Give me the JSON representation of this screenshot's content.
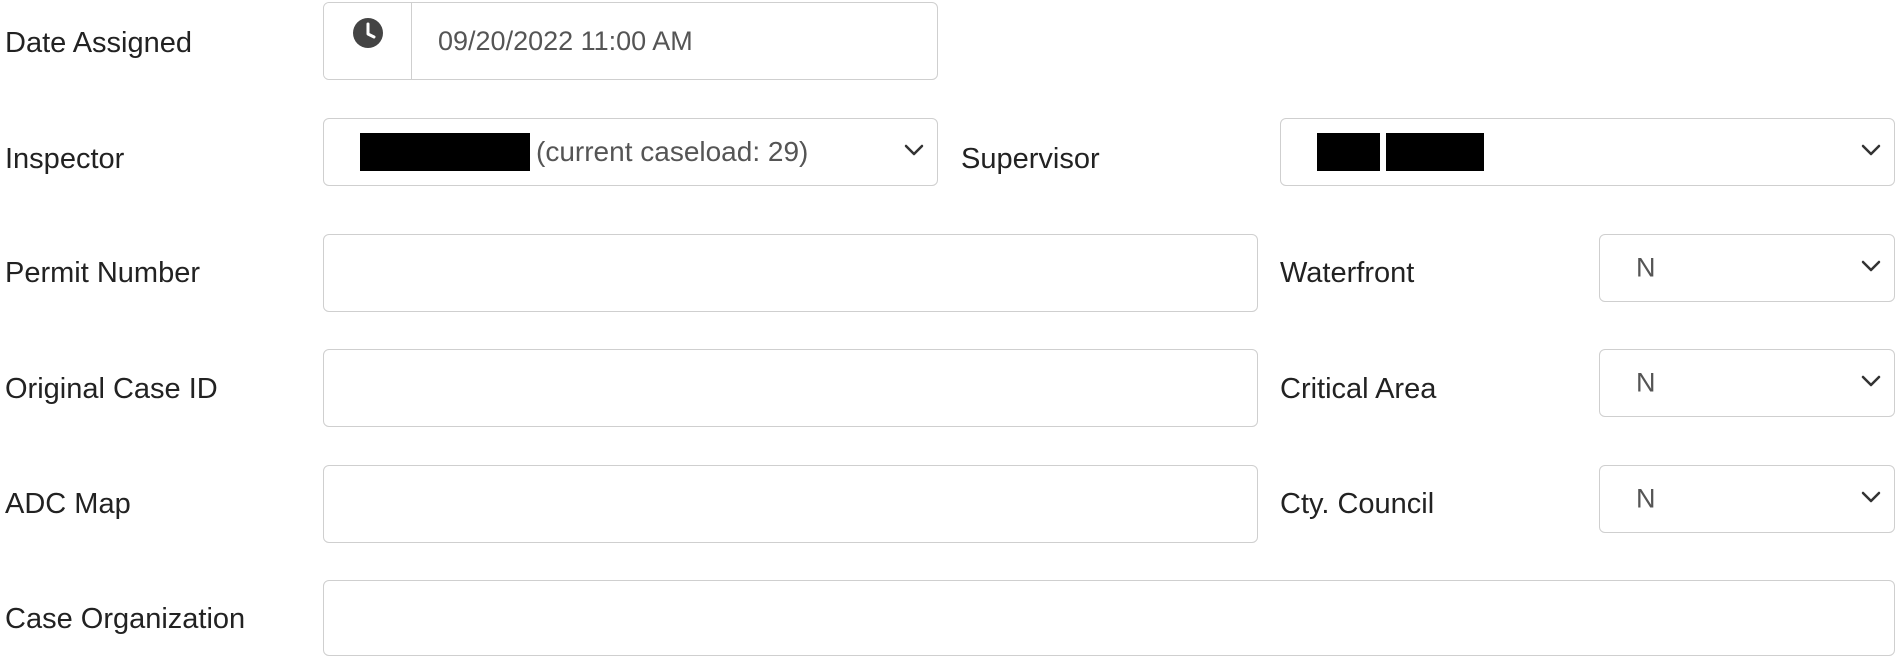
{
  "form": {
    "date_assigned": {
      "label": "Date Assigned",
      "value": "09/20/2022 11:00 AM",
      "icon": "clock-icon"
    },
    "inspector": {
      "label": "Inspector",
      "value_suffix": "(current caseload: 29)",
      "icon": "chevron-down-icon"
    },
    "supervisor": {
      "label": "Supervisor",
      "icon": "chevron-down-icon"
    },
    "permit_number": {
      "label": "Permit Number",
      "value": ""
    },
    "waterfront": {
      "label": "Waterfront",
      "value": "N"
    },
    "original_case_id": {
      "label": "Original Case ID",
      "value": ""
    },
    "critical_area": {
      "label": "Critical Area",
      "value": "N"
    },
    "adc_map": {
      "label": "ADC Map",
      "value": ""
    },
    "cty_council": {
      "label": "Cty. Council",
      "value": "N"
    },
    "case_organization": {
      "label": "Case Organization",
      "value": ""
    }
  },
  "colors": {
    "border": "#cfcfcf",
    "label_text": "#222222",
    "input_text": "#555555",
    "redaction": "#000000"
  }
}
